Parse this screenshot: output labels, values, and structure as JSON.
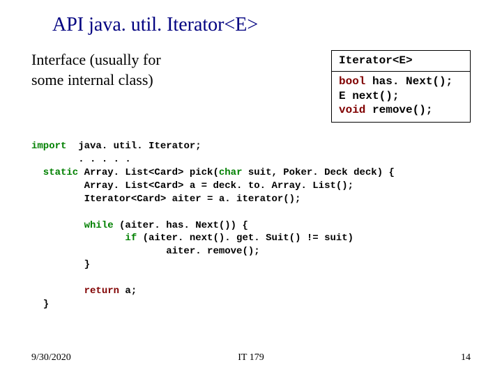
{
  "title": "API  java. util. Iterator<E>",
  "interface_desc_line1": "Interface (usually for",
  "interface_desc_line2": "some internal class)",
  "iterator_box": {
    "header": "Iterator<E>",
    "line1_kw": "bool",
    "line1_rest": " has. Next();",
    "line2": "E next();",
    "line3_kw": "void",
    "line3_rest": " remove();"
  },
  "code": {
    "l1_kw": "import",
    "l1_rest": "  java. util. Iterator;",
    "l2": "        . . . . .",
    "l3_kw": "  static",
    "l3_rest_a": " Array. List<Card> pick(",
    "l3_char": "char",
    "l3_rest_b": " suit, Poker. Deck deck) {",
    "l4": "         Array. List<Card> a = deck. to. Array. List();",
    "l5": "         Iterator<Card> aiter = a. iterator();",
    "l6_kw": "         while",
    "l6_rest": " (aiter. has. Next()) {",
    "l7_kw": "                if",
    "l7_rest": " (aiter. next(). get. Suit() != suit)",
    "l8": "                       aiter. remove();",
    "l9": "         }",
    "l10_kw": "         return",
    "l10_rest": " a;",
    "l11": "  }"
  },
  "footer": {
    "date": "9/30/2020",
    "course": "IT 179",
    "page": "14"
  }
}
